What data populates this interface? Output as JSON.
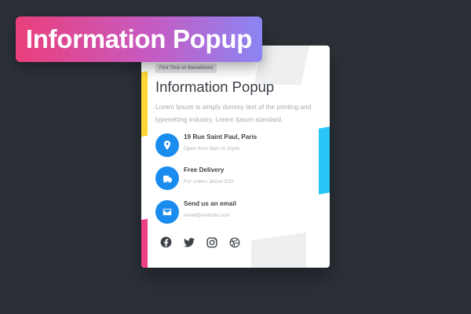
{
  "banner": {
    "title": "Information Popup"
  },
  "popup": {
    "tag": "First Time on themeforest",
    "title": "Information Popup",
    "description": "Lorem Ipsum is simply dummy text of the printing and typesetting industry. Lorem Ipsum standard.",
    "items": [
      {
        "icon": "location-pin-icon",
        "title": "19 Rue Saint Paul, Paris",
        "subtitle": "Open from 9am to 11pm"
      },
      {
        "icon": "delivery-icon",
        "title": "Free Delivery",
        "subtitle": "For orders above $20"
      },
      {
        "icon": "email-icon",
        "title": "Send us an email",
        "subtitle": "email@website.com"
      }
    ],
    "social": [
      "facebook-icon",
      "twitter-icon",
      "instagram-icon",
      "dribbble-icon"
    ]
  },
  "colors": {
    "background": "#2c3138",
    "accent": "#1a8cf0",
    "banner_gradient": [
      "#ea3f7b",
      "#8b85f3"
    ],
    "deco_yellow": "#fdd835",
    "deco_pink": "#ef3f87",
    "deco_cyan": "#29c5f6"
  }
}
